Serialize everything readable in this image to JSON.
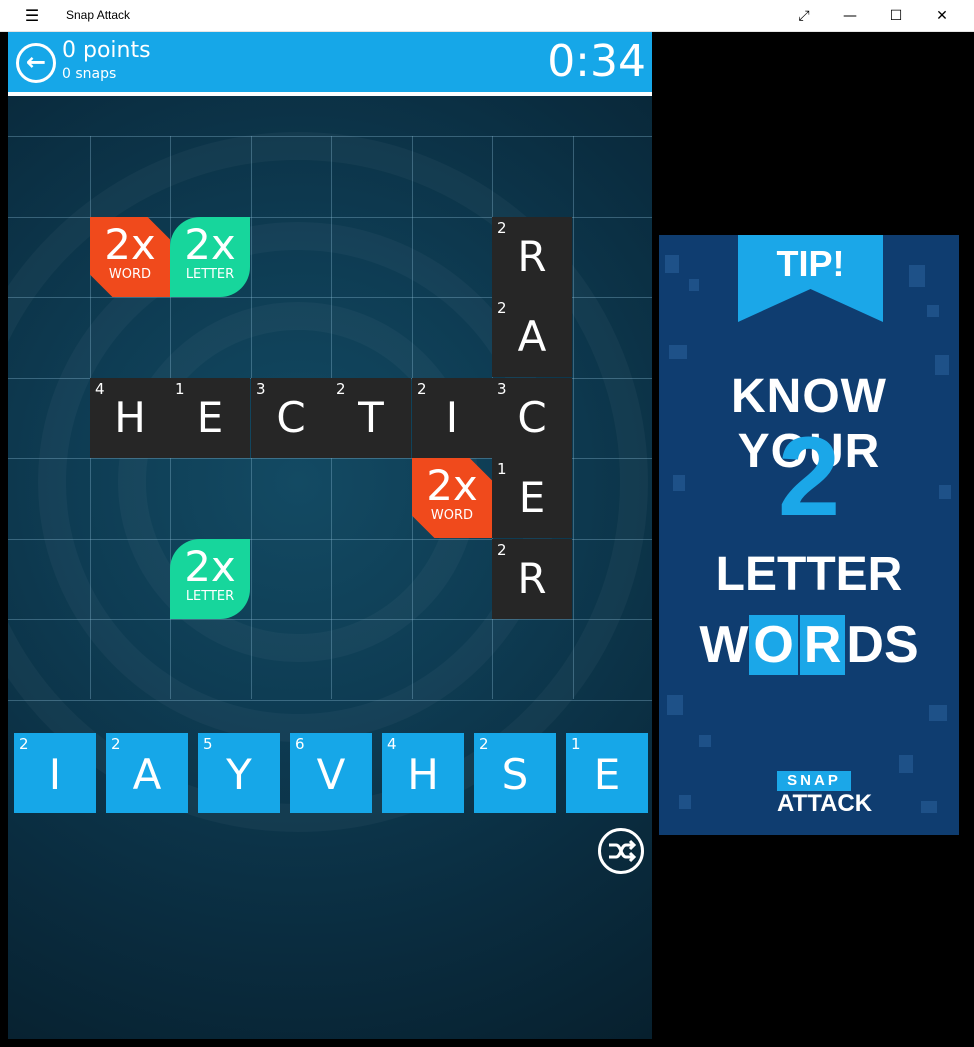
{
  "window": {
    "title": "Snap Attack",
    "menu_icon": "hamburger-icon",
    "buttons": [
      "restore-icon",
      "minimize-icon",
      "maximize-icon",
      "close-icon"
    ]
  },
  "header": {
    "points": "0 points",
    "snaps": "0 snaps",
    "timer": "0:34",
    "back_icon": "back-arrow-icon"
  },
  "colors": {
    "accent_blue": "#16a7e8",
    "word_bonus": "#f04a1c",
    "letter_bonus": "#17d69c",
    "placed_tile": "#262626"
  },
  "board": {
    "placed_tiles": [
      {
        "letter": "R",
        "points": "2",
        "col": 6,
        "row": 1
      },
      {
        "letter": "A",
        "points": "2",
        "col": 6,
        "row": 2
      },
      {
        "letter": "H",
        "points": "4",
        "col": 1,
        "row": 3
      },
      {
        "letter": "E",
        "points": "1",
        "col": 2,
        "row": 3
      },
      {
        "letter": "C",
        "points": "3",
        "col": 3,
        "row": 3
      },
      {
        "letter": "T",
        "points": "2",
        "col": 4,
        "row": 3
      },
      {
        "letter": "I",
        "points": "2",
        "col": 5,
        "row": 3
      },
      {
        "letter": "C",
        "points": "3",
        "col": 6,
        "row": 3
      },
      {
        "letter": "E",
        "points": "1",
        "col": 6,
        "row": 4
      },
      {
        "letter": "R",
        "points": "2",
        "col": 6,
        "row": 5
      }
    ],
    "bonuses": [
      {
        "type": "word",
        "big": "2x",
        "small": "WORD",
        "col": 1,
        "row": 1
      },
      {
        "type": "letter",
        "big": "2x",
        "small": "LETTER",
        "col": 2,
        "row": 1
      },
      {
        "type": "word",
        "big": "2x",
        "small": "WORD",
        "col": 5,
        "row": 4
      },
      {
        "type": "letter",
        "big": "2x",
        "small": "LETTER",
        "col": 2,
        "row": 5
      }
    ]
  },
  "rack": {
    "tiles": [
      {
        "letter": "I",
        "points": "2"
      },
      {
        "letter": "A",
        "points": "2"
      },
      {
        "letter": "Y",
        "points": "5"
      },
      {
        "letter": "V",
        "points": "6"
      },
      {
        "letter": "H",
        "points": "4"
      },
      {
        "letter": "S",
        "points": "2"
      },
      {
        "letter": "E",
        "points": "1"
      }
    ],
    "shuffle_icon": "shuffle-icon"
  },
  "tip": {
    "label": "TIP!",
    "line1": "KNOW YOUR",
    "number": "2",
    "line3": "LETTER",
    "line4_parts": [
      "W",
      "O",
      "R",
      "DS"
    ],
    "logo_top": "SNAP",
    "logo_bottom": "ATTACK"
  }
}
